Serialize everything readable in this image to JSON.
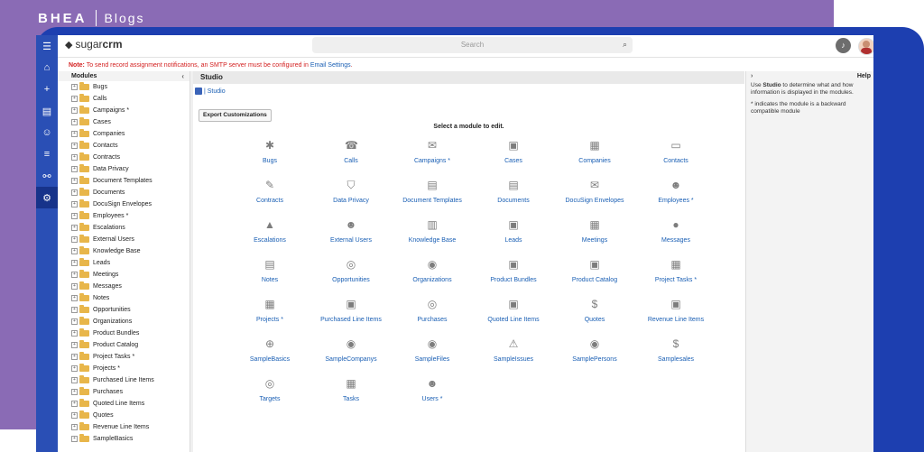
{
  "brand": {
    "logo": "BHEA",
    "section": "Blogs"
  },
  "topbar": {
    "logo_plain": "sugar",
    "logo_bold": "crm",
    "search_placeholder": "Search"
  },
  "notice": {
    "label": "Note:",
    "text": "To send record assignment notifications, an SMTP server must be configured in",
    "link": "Email Settings",
    "end": "."
  },
  "modules": {
    "header": "Modules",
    "items": [
      "Bugs",
      "Calls",
      "Campaigns *",
      "Cases",
      "Companies",
      "Contacts",
      "Contracts",
      "Data Privacy",
      "Document Templates",
      "Documents",
      "DocuSign Envelopes",
      "Employees *",
      "Escalations",
      "External Users",
      "Knowledge Base",
      "Leads",
      "Meetings",
      "Messages",
      "Notes",
      "Opportunities",
      "Organizations",
      "Product Bundles",
      "Product Catalog",
      "Project Tasks *",
      "Projects *",
      "Purchased Line Items",
      "Purchases",
      "Quoted Line Items",
      "Quotes",
      "Revenue Line Items",
      "SampleBasics"
    ]
  },
  "studio": {
    "tab": "Studio",
    "breadcrumb": "| Studio",
    "export_label": "Export Customizations",
    "select_title": "Select a module to edit.",
    "grid": [
      {
        "label": "Bugs",
        "icon": "bug-icon"
      },
      {
        "label": "Calls",
        "icon": "phone-icon"
      },
      {
        "label": "Campaigns *",
        "icon": "campaign-icon"
      },
      {
        "label": "Cases",
        "icon": "case-icon"
      },
      {
        "label": "Companies",
        "icon": "building-icon"
      },
      {
        "label": "Contacts",
        "icon": "contact-card-icon"
      },
      {
        "label": "Contracts",
        "icon": "contract-icon"
      },
      {
        "label": "Data Privacy",
        "icon": "shield-icon"
      },
      {
        "label": "Document Templates",
        "icon": "document-template-icon"
      },
      {
        "label": "Documents",
        "icon": "document-icon"
      },
      {
        "label": "DocuSign Envelopes",
        "icon": "envelope-icon"
      },
      {
        "label": "Employees *",
        "icon": "employee-icon"
      },
      {
        "label": "Escalations",
        "icon": "arrow-up-icon"
      },
      {
        "label": "External Users",
        "icon": "external-user-icon"
      },
      {
        "label": "Knowledge Base",
        "icon": "book-icon"
      },
      {
        "label": "Leads",
        "icon": "lead-icon"
      },
      {
        "label": "Meetings",
        "icon": "calendar-icon"
      },
      {
        "label": "Messages",
        "icon": "chat-icon"
      },
      {
        "label": "Notes",
        "icon": "note-icon"
      },
      {
        "label": "Opportunities",
        "icon": "coins-icon"
      },
      {
        "label": "Organizations",
        "icon": "organization-icon"
      },
      {
        "label": "Product Bundles",
        "icon": "bundle-icon"
      },
      {
        "label": "Product Catalog",
        "icon": "catalog-icon"
      },
      {
        "label": "Project Tasks *",
        "icon": "task-calendar-icon"
      },
      {
        "label": "Projects *",
        "icon": "project-icon"
      },
      {
        "label": "Purchased Line Items",
        "icon": "purchased-items-icon"
      },
      {
        "label": "Purchases",
        "icon": "purchase-icon"
      },
      {
        "label": "Quoted Line Items",
        "icon": "quoted-items-icon"
      },
      {
        "label": "Quotes",
        "icon": "quote-icon"
      },
      {
        "label": "Revenue Line Items",
        "icon": "revenue-items-icon"
      },
      {
        "label": "SampleBasics",
        "icon": "plus-circle-icon"
      },
      {
        "label": "SampleCompanys",
        "icon": "sample-company-icon"
      },
      {
        "label": "SampleFiles",
        "icon": "sample-file-icon"
      },
      {
        "label": "SampleIssues",
        "icon": "warning-icon"
      },
      {
        "label": "SamplePersons",
        "icon": "person-circle-icon"
      },
      {
        "label": "Samplesales",
        "icon": "dollar-icon"
      },
      {
        "label": "Targets",
        "icon": "target-icon"
      },
      {
        "label": "Tasks",
        "icon": "tasks-icon"
      },
      {
        "label": "Users *",
        "icon": "user-icon"
      }
    ]
  },
  "help": {
    "title": "Help",
    "p1_pre": "Use",
    "p1_bold": "Studio",
    "p1_post": "to determine what and how information is displayed in the modules.",
    "p2": "* indicates the module is a backward compatible module"
  },
  "colors": {
    "purple": "#8a6bb5",
    "blue": "#1d3fb0",
    "nav": "#2a4fb5",
    "link": "#1a5fb4",
    "warning": "#d32020"
  }
}
